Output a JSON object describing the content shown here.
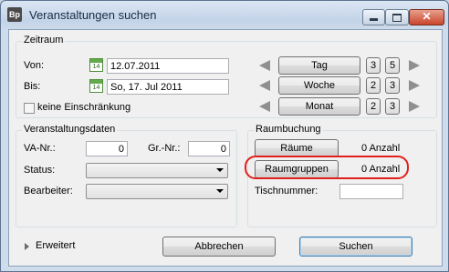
{
  "window": {
    "title": "Veranstaltungen suchen",
    "app_icon_text": "Bp",
    "close_glyph": "✕"
  },
  "zeitraum": {
    "group_title": "Zeitraum",
    "von_label": "Von:",
    "von_value": "12.07.2011",
    "bis_label": "Bis:",
    "bis_value": "So, 17. Jul 2011",
    "no_limit_label": "keine Einschränkung",
    "no_limit_checked": false,
    "calendar_icon_text": "14",
    "rows": [
      {
        "button": "Tag",
        "n1": "3",
        "n2": "5"
      },
      {
        "button": "Woche",
        "n1": "2",
        "n2": "3"
      },
      {
        "button": "Monat",
        "n1": "2",
        "n2": "3"
      }
    ]
  },
  "veranstaltungsdaten": {
    "group_title": "Veranstaltungsdaten",
    "va_nr_label": "VA-Nr.:",
    "va_nr_value": "0",
    "gr_nr_label": "Gr.-Nr.:",
    "gr_nr_value": "0",
    "status_label": "Status:",
    "status_value": "",
    "bearbeiter_label": "Bearbeiter:",
    "bearbeiter_value": ""
  },
  "raumbuchung": {
    "group_title": "Raumbuchung",
    "raeume_button": "Räume",
    "raeume_count": "0 Anzahl",
    "raumgruppen_button": "Raumgruppen",
    "raumgruppen_count": "0 Anzahl",
    "tischnummer_label": "Tischnummer:",
    "tischnummer_value": ""
  },
  "footer": {
    "expand_label": "Erweitert",
    "cancel_button": "Abbrechen",
    "search_button": "Suchen"
  },
  "colors": {
    "highlight": "#e0201c",
    "calendar_green": "#64a94b"
  }
}
